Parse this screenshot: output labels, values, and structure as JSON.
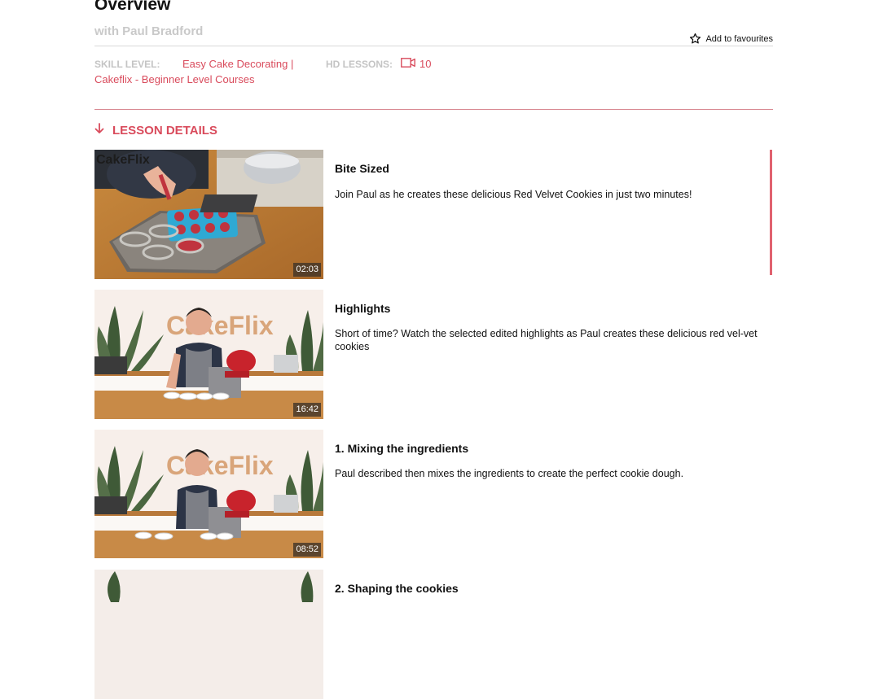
{
  "header": {
    "title": "Overview",
    "subtitle": "with Paul Bradford",
    "favourites_label": "Add to favourites"
  },
  "meta": {
    "skill_level_label": "SKILL LEVEL:",
    "skill_level_value_line1": "Easy Cake Decorating |",
    "skill_level_value_line2": "Cakeflix - Beginner Level Courses",
    "hd_lessons_label": "HD LESSONS:",
    "hd_lessons_count": "10"
  },
  "section": {
    "lesson_details_label": "LESSON DETAILS"
  },
  "lessons": [
    {
      "title": "Bite Sized",
      "description": "Join Paul as he creates these delicious Red Velvet Cookies in just two minutes!",
      "duration": "02:03",
      "active": true
    },
    {
      "title": "Highlights",
      "description": "Short of time? Watch the selected edited highlights as Paul creates these delicious red vel-vet cookies",
      "duration": "16:42",
      "active": false
    },
    {
      "title": "1. Mixing the ingredients",
      "description": "Paul described then mixes the ingredients to create the perfect cookie dough.",
      "duration": "08:52",
      "active": false
    },
    {
      "title": "2. Shaping the cookies",
      "description": "",
      "duration": "",
      "active": false
    }
  ],
  "thumbnail_brand": {
    "wall_logo": "CakeFlix",
    "corner_logo": "CakeFlix"
  },
  "icons": {
    "favourites": "star-outline-icon",
    "hd_lessons": "video-camera-icon",
    "lesson_details": "arrow-down-icon"
  },
  "colors": {
    "accent": "#d94b5c",
    "accent_bar": "#e0626f",
    "muted_text": "#c4c4c4",
    "divider": "#d98a93"
  }
}
